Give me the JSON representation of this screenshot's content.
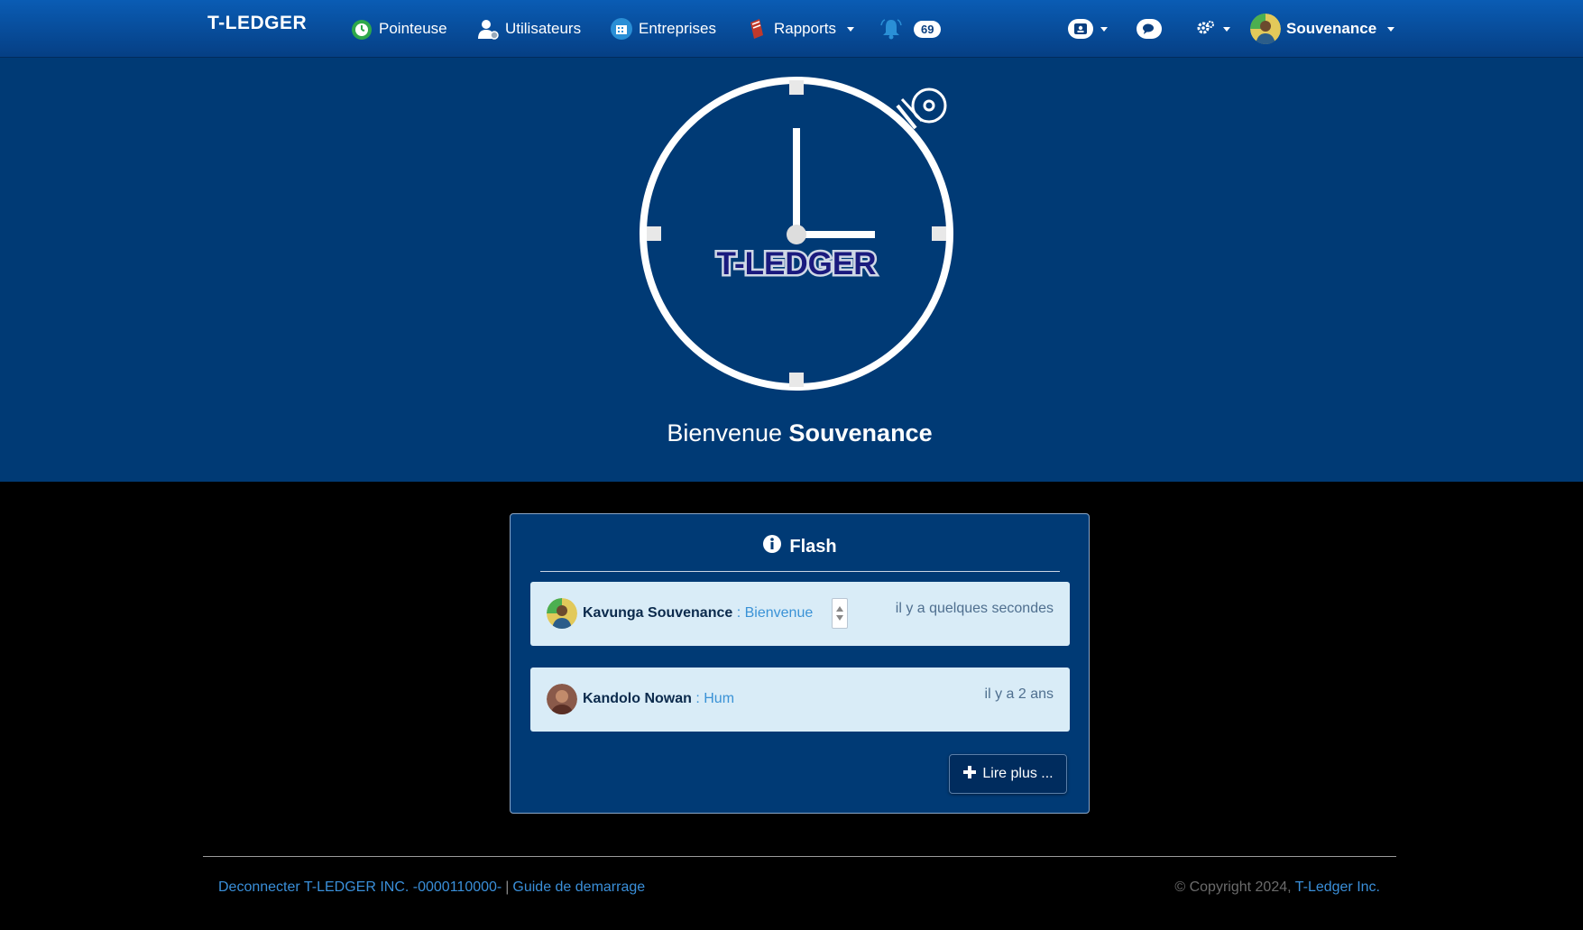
{
  "navbar": {
    "brand": "T-LEDGER",
    "items": [
      {
        "label": "Pointeuse"
      },
      {
        "label": "Utilisateurs"
      },
      {
        "label": "Entreprises"
      },
      {
        "label": "Rapports"
      }
    ],
    "notifications_count": "69",
    "user_name": "Souvenance"
  },
  "hero": {
    "logo_text": "T-LEDGER",
    "welcome_prefix": "Bienvenue",
    "welcome_name": "Souvenance"
  },
  "flash": {
    "title": "Flash",
    "messages": [
      {
        "author": "Kavunga Souvenance",
        "separator": " : ",
        "text": "Bienvenue",
        "time": "il y a quelques secondes"
      },
      {
        "author": "Kandolo Nowan",
        "separator": " : ",
        "text": "Hum",
        "time": "il y a 2 ans"
      }
    ],
    "more_label": "Lire plus ..."
  },
  "footer": {
    "logout_label": "Deconnecter T-LEDGER INC. -0000110000-",
    "pipe": "|",
    "guide_label": "Guide de demarrage",
    "copyright": "© Copyright 2024,",
    "company_link": "T-Ledger Inc."
  },
  "colors": {
    "nav_top": "#0a5cb4",
    "hero_bg": "#003a75",
    "link": "#3a8fd9",
    "message_bg": "#d9ecf7"
  }
}
